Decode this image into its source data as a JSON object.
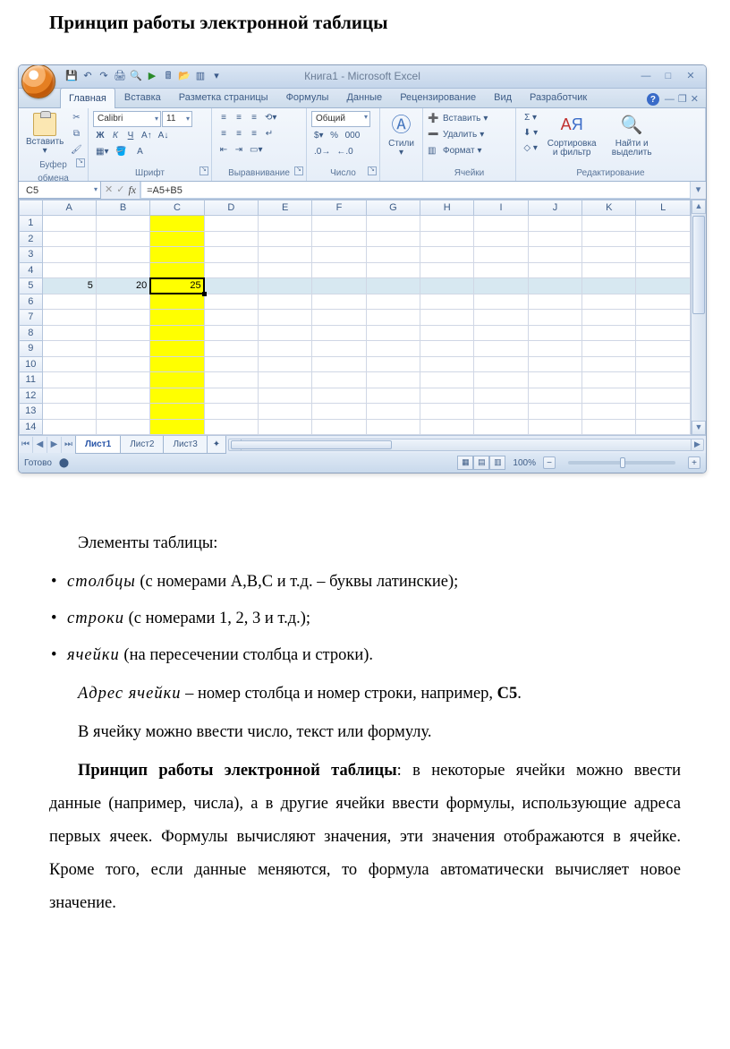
{
  "doc": {
    "title": "Принцип работы электронной таблицы",
    "elements_label": "Элементы таблицы:",
    "bullet_cols_it": "столбцы",
    "bullet_cols_rest": " (с номерами A,B,C и т.д. – буквы латинские);",
    "bullet_rows_it": "строки",
    "bullet_rows_rest": " (с номерами 1, 2, 3 и т.д.);",
    "bullet_cells_it": "ячейки",
    "bullet_cells_rest": " (на пересечении столбца и строки).",
    "addr_it": "Адрес ячейки",
    "addr_rest_a": " – номер столбца и номер строки, например, ",
    "addr_bold": "C5",
    "addr_rest_b": ".",
    "para_cell_input": "В ячейку можно ввести число, текст или формулу.",
    "principle_bold": "Принцип работы электронной таблицы",
    "principle_rest": ": в некоторые ячейки можно ввести данные (например, числа), а в другие ячейки ввести формулы, использующие адреса первых ячеек. Формулы вычисляют значения, эти значения отображаются в ячейке. Кроме того, если данные меняются, то формула автоматически вычисляет новое значение."
  },
  "excel": {
    "title": "Книга1 - Microsoft Excel",
    "tabs": [
      "Главная",
      "Вставка",
      "Разметка страницы",
      "Формулы",
      "Данные",
      "Рецензирование",
      "Вид",
      "Разработчик"
    ],
    "groups": {
      "clipboard": "Буфер обмена",
      "font": "Шрифт",
      "align": "Выравнивание",
      "number": "Число",
      "styles": "Стили",
      "cells_lbl": "Ячейки",
      "editing": "Редактирование"
    },
    "paste": "Вставить",
    "styles_btn": "Стили",
    "font_name": "Calibri",
    "font_size": "11",
    "number_fmt": "Общий",
    "cells": {
      "insert": "Вставить",
      "delete": "Удалить",
      "format": "Формат"
    },
    "sort": "Сортировка и фильтр",
    "find": "Найти и выделить",
    "namebox": "C5",
    "formula": "=A5+B5",
    "cols": [
      "A",
      "B",
      "C",
      "D",
      "E",
      "F",
      "G",
      "H",
      "I",
      "J",
      "K",
      "L"
    ],
    "rows": 14,
    "data": {
      "A5": "5",
      "B5": "20",
      "C5": "25"
    },
    "sheets": [
      "Лист1",
      "Лист2",
      "Лист3"
    ],
    "status": "Готово",
    "zoom": "100%"
  }
}
